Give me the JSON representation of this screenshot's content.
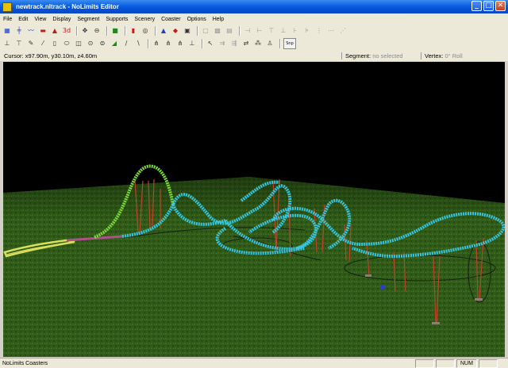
{
  "window": {
    "title": "newtrack.nltrack - NoLimits Editor",
    "controls": [
      "_",
      "□",
      "✕"
    ]
  },
  "menu": [
    "File",
    "Edit",
    "View",
    "Display",
    "Segment",
    "Supports",
    "Scenery",
    "Coaster",
    "Options",
    "Help"
  ],
  "toolbar": {
    "row1": [
      "grid-icon",
      "track-icon",
      "wave-icon",
      "train-icon",
      "terrain-icon",
      "3d-icon",
      "move-icon",
      "flatten-icon",
      "camera-icon",
      "traffic-light-icon",
      "globe-icon",
      "warning-icon",
      "save-icon",
      "window-icon",
      "layout-icon",
      "rect-icon",
      "table-icon",
      "split-icon",
      "merge-icon",
      "node-icon",
      "insert-icon",
      "edit-icon",
      "join-icon",
      "xyz-icon",
      "xyz2-icon",
      "xyz3-icon"
    ],
    "row1_text_3d": "3d",
    "row2": [
      "pillar-icon",
      "pillar2-icon",
      "pencil-icon",
      "brush-icon",
      "bar-icon",
      "capsule-icon",
      "drum-icon",
      "barrel-icon",
      "cylinder-icon",
      "wedge-icon",
      "arm-icon",
      "arm2-icon",
      "fork-icon",
      "fork2-icon",
      "fork3-icon",
      "ground-icon",
      "cursor-icon",
      "dual-icon",
      "dual2-icon",
      "dual3-icon",
      "tri-icon",
      "person-icon"
    ],
    "snap_label": "Snp"
  },
  "status_top": {
    "cursor_label": "Cursor:",
    "cursor_value": "x97.90m, y30.10m, z4.60m",
    "segment_label": "Segment:",
    "segment_value": "no selected",
    "vertex_label": "Vertex:",
    "vertex_value": "0° Roll"
  },
  "statusbar": {
    "text": "NoLimits Coasters",
    "num": "NUM"
  },
  "colors": {
    "sky": "#000000",
    "ground": "#2f5a17",
    "lift": "#7bd93a",
    "track": "#36c6e0",
    "station": "#d8e05a",
    "brake": "#b0508a",
    "supports": "#c0432a"
  }
}
